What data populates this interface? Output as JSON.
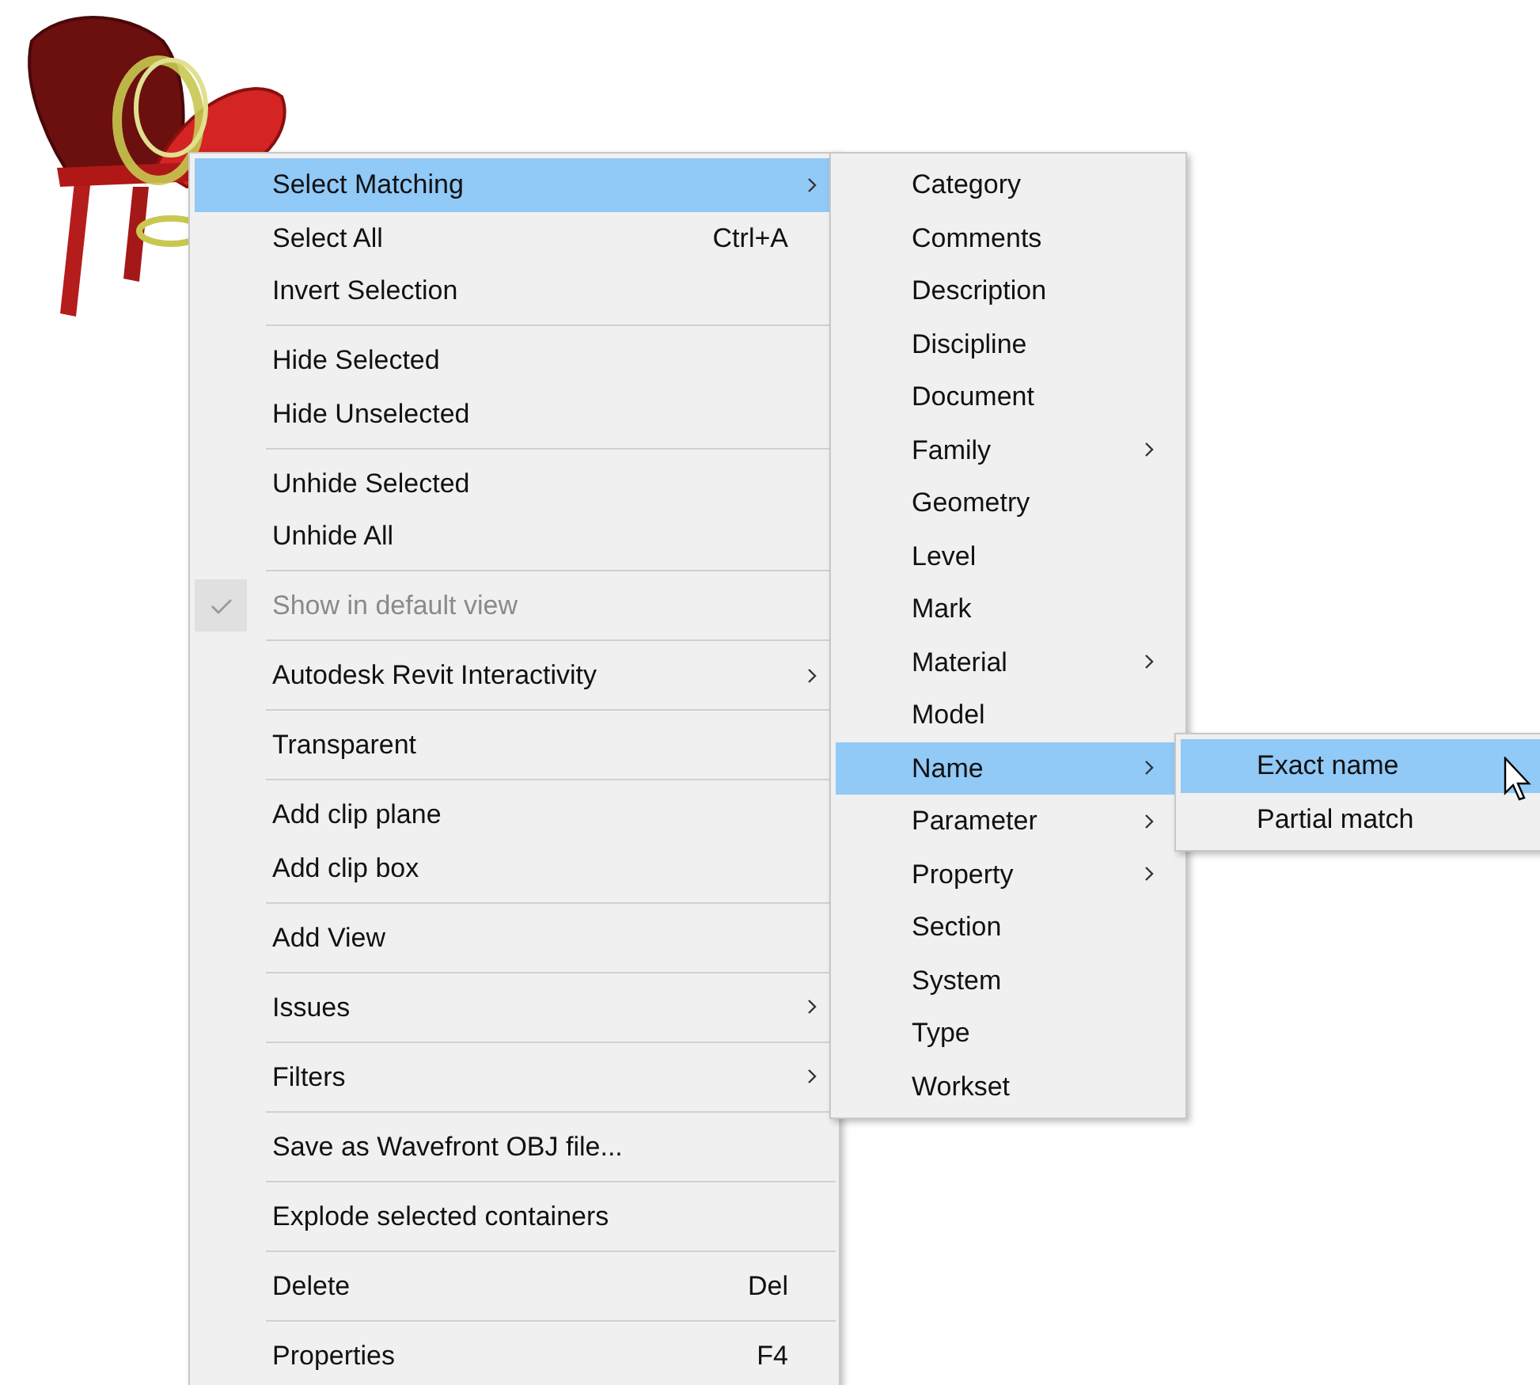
{
  "main_menu": {
    "groups": [
      {
        "items": [
          {
            "label": "Select Matching",
            "submenu": true,
            "selected": true,
            "disabled": false,
            "checked": false
          },
          {
            "label": "Select All",
            "shortcut": "Ctrl+A",
            "submenu": false,
            "selected": false,
            "disabled": false,
            "checked": false
          },
          {
            "label": "Invert Selection",
            "submenu": false,
            "selected": false,
            "disabled": false,
            "checked": false
          }
        ]
      },
      {
        "items": [
          {
            "label": "Hide Selected",
            "submenu": false,
            "selected": false,
            "disabled": false,
            "checked": false
          },
          {
            "label": "Hide Unselected",
            "submenu": false,
            "selected": false,
            "disabled": false,
            "checked": false
          }
        ]
      },
      {
        "items": [
          {
            "label": "Unhide Selected",
            "submenu": false,
            "selected": false,
            "disabled": false,
            "checked": false
          },
          {
            "label": "Unhide All",
            "submenu": false,
            "selected": false,
            "disabled": false,
            "checked": false
          }
        ]
      },
      {
        "items": [
          {
            "label": "Show in default view",
            "submenu": false,
            "selected": false,
            "disabled": true,
            "checked": true
          }
        ]
      },
      {
        "items": [
          {
            "label": "Autodesk Revit Interactivity",
            "submenu": true,
            "selected": false,
            "disabled": false,
            "checked": false
          }
        ]
      },
      {
        "items": [
          {
            "label": "Transparent",
            "submenu": false,
            "selected": false,
            "disabled": false,
            "checked": false
          }
        ]
      },
      {
        "items": [
          {
            "label": "Add clip plane",
            "submenu": false,
            "selected": false,
            "disabled": false,
            "checked": false
          },
          {
            "label": "Add clip box",
            "submenu": false,
            "selected": false,
            "disabled": false,
            "checked": false
          }
        ]
      },
      {
        "items": [
          {
            "label": "Add View",
            "submenu": false,
            "selected": false,
            "disabled": false,
            "checked": false
          }
        ]
      },
      {
        "items": [
          {
            "label": "Issues",
            "submenu": true,
            "selected": false,
            "disabled": false,
            "checked": false
          }
        ]
      },
      {
        "items": [
          {
            "label": "Filters",
            "submenu": true,
            "selected": false,
            "disabled": false,
            "checked": false
          }
        ]
      },
      {
        "items": [
          {
            "label": "Save as Wavefront OBJ file...",
            "submenu": false,
            "selected": false,
            "disabled": false,
            "checked": false
          }
        ]
      },
      {
        "items": [
          {
            "label": "Explode selected containers",
            "submenu": false,
            "selected": false,
            "disabled": false,
            "checked": false
          }
        ]
      },
      {
        "items": [
          {
            "label": "Delete",
            "shortcut": "Del",
            "submenu": false,
            "selected": false,
            "disabled": false,
            "checked": false
          }
        ]
      },
      {
        "items": [
          {
            "label": "Properties",
            "shortcut": "F4",
            "submenu": false,
            "selected": false,
            "disabled": false,
            "checked": false
          }
        ]
      }
    ]
  },
  "matching_menu": {
    "items": [
      {
        "label": "Category",
        "submenu": false,
        "selected": false
      },
      {
        "label": "Comments",
        "submenu": false,
        "selected": false
      },
      {
        "label": "Description",
        "submenu": false,
        "selected": false
      },
      {
        "label": "Discipline",
        "submenu": false,
        "selected": false
      },
      {
        "label": "Document",
        "submenu": false,
        "selected": false
      },
      {
        "label": "Family",
        "submenu": true,
        "selected": false
      },
      {
        "label": "Geometry",
        "submenu": false,
        "selected": false
      },
      {
        "label": "Level",
        "submenu": false,
        "selected": false
      },
      {
        "label": "Mark",
        "submenu": false,
        "selected": false
      },
      {
        "label": "Material",
        "submenu": true,
        "selected": false
      },
      {
        "label": "Model",
        "submenu": false,
        "selected": false
      },
      {
        "label": "Name",
        "submenu": true,
        "selected": true
      },
      {
        "label": "Parameter",
        "submenu": true,
        "selected": false
      },
      {
        "label": "Property",
        "submenu": true,
        "selected": false
      },
      {
        "label": "Section",
        "submenu": false,
        "selected": false
      },
      {
        "label": "System",
        "submenu": false,
        "selected": false
      },
      {
        "label": "Type",
        "submenu": false,
        "selected": false
      },
      {
        "label": "Workset",
        "submenu": false,
        "selected": false
      }
    ]
  },
  "name_menu": {
    "items": [
      {
        "label": "Exact name",
        "selected": true
      },
      {
        "label": "Partial match",
        "selected": false
      }
    ]
  }
}
